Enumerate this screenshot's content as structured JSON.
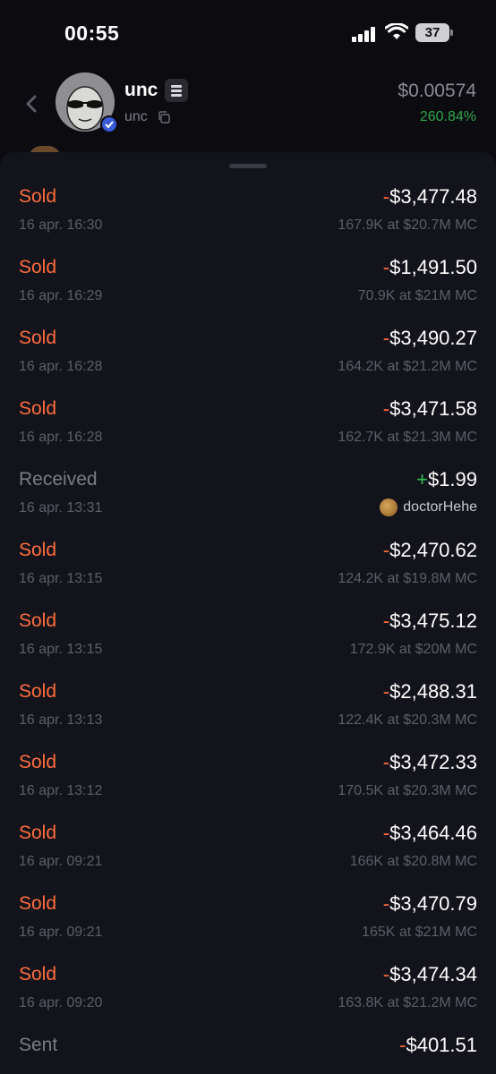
{
  "status_bar": {
    "time": "00:55",
    "battery": "37"
  },
  "token": {
    "name": "unc",
    "ticker": "unc",
    "price": "$0.00574",
    "change": "260.84%"
  },
  "transactions": [
    {
      "type": "Sold",
      "sign": "-",
      "amount": "$3,477.48",
      "date": "16 apr. 16:30",
      "detail": "167.9K at $20.7M MC"
    },
    {
      "type": "Sold",
      "sign": "-",
      "amount": "$1,491.50",
      "date": "16 apr. 16:29",
      "detail": "70.9K at $21M MC"
    },
    {
      "type": "Sold",
      "sign": "-",
      "amount": "$3,490.27",
      "date": "16 apr. 16:28",
      "detail": "164.2K at $21.2M MC"
    },
    {
      "type": "Sold",
      "sign": "-",
      "amount": "$3,471.58",
      "date": "16 apr. 16:28",
      "detail": "162.7K at $21.3M MC"
    },
    {
      "type": "Received",
      "sign": "+",
      "amount": "$1.99",
      "date": "16 apr. 13:31",
      "user": "doctorHehe"
    },
    {
      "type": "Sold",
      "sign": "-",
      "amount": "$2,470.62",
      "date": "16 apr. 13:15",
      "detail": "124.2K at $19.8M MC"
    },
    {
      "type": "Sold",
      "sign": "-",
      "amount": "$3,475.12",
      "date": "16 apr. 13:15",
      "detail": "172.9K at $20M MC"
    },
    {
      "type": "Sold",
      "sign": "-",
      "amount": "$2,488.31",
      "date": "16 apr. 13:13",
      "detail": "122.4K at $20.3M MC"
    },
    {
      "type": "Sold",
      "sign": "-",
      "amount": "$3,472.33",
      "date": "16 apr. 13:12",
      "detail": "170.5K at $20.3M MC"
    },
    {
      "type": "Sold",
      "sign": "-",
      "amount": "$3,464.46",
      "date": "16 apr. 09:21",
      "detail": "166K at $20.8M MC"
    },
    {
      "type": "Sold",
      "sign": "-",
      "amount": "$3,470.79",
      "date": "16 apr. 09:21",
      "detail": "165K at $21M MC"
    },
    {
      "type": "Sold",
      "sign": "-",
      "amount": "$3,474.34",
      "date": "16 apr. 09:20",
      "detail": "163.8K at $21.2M MC"
    },
    {
      "type": "Sent",
      "sign": "-",
      "amount": "$401.51",
      "date": "",
      "detail": ""
    }
  ],
  "colors": {
    "sold": "#ff6d3d",
    "positive": "#2fc152",
    "muted": "#7c7c86"
  }
}
